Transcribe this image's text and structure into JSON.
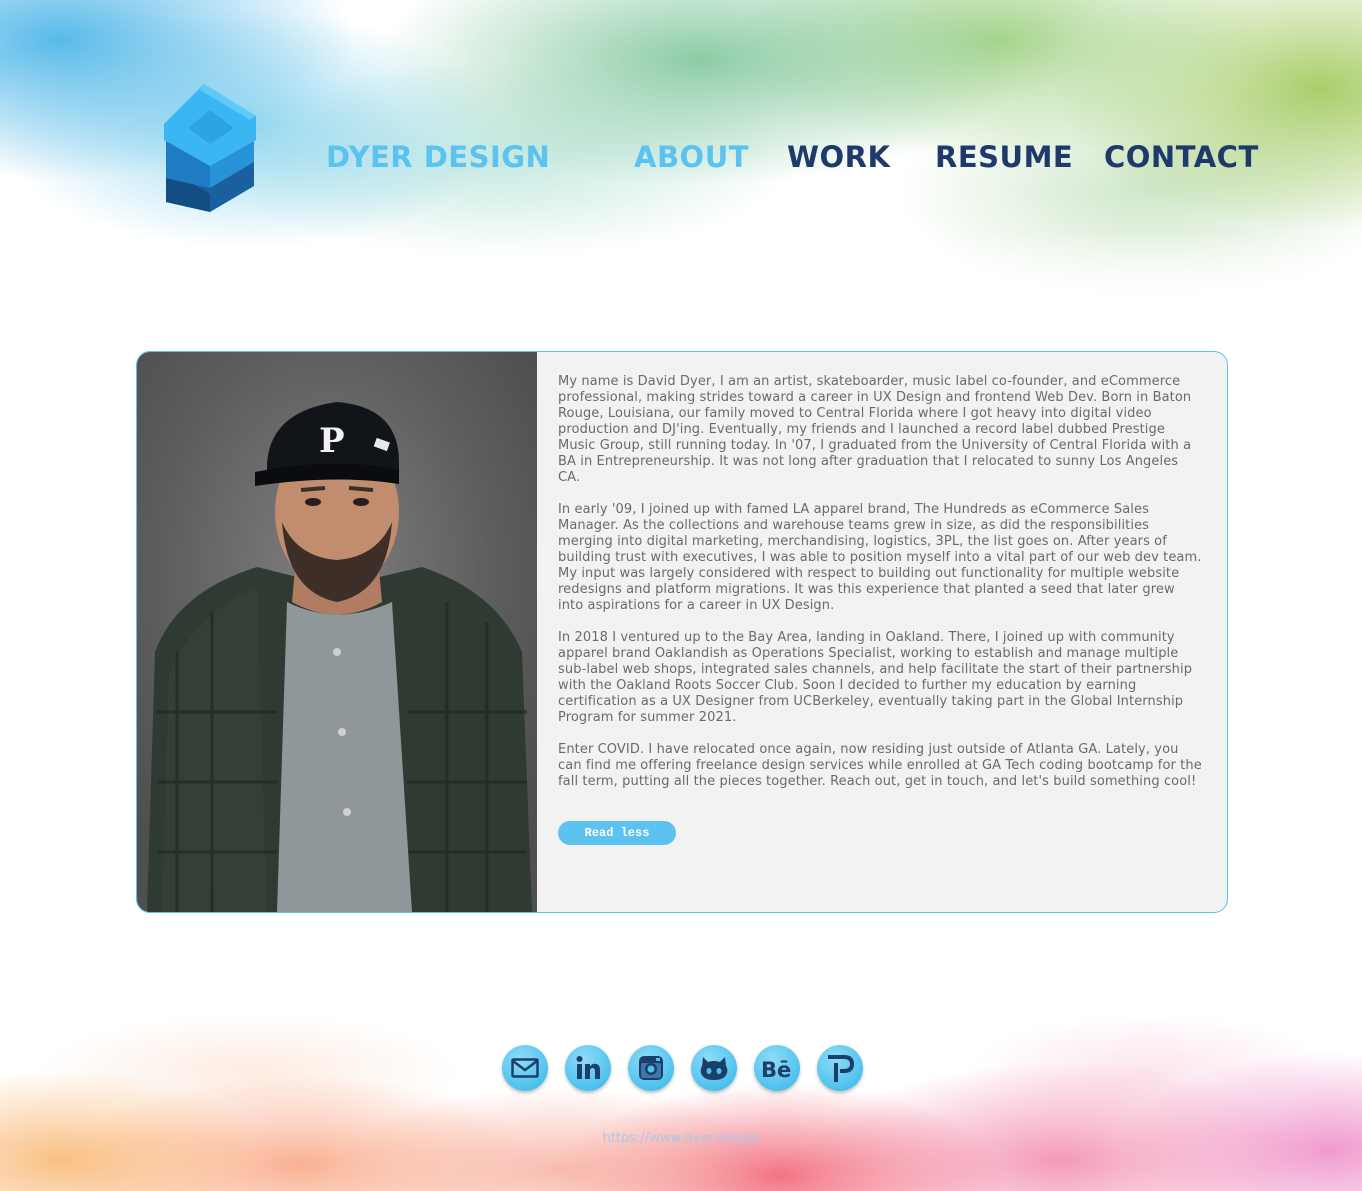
{
  "header": {
    "brand": "DYER DESIGN",
    "nav": [
      {
        "label": "ABOUT",
        "active": true
      },
      {
        "label": "WORK",
        "active": false
      },
      {
        "label": "RESUME",
        "active": false
      },
      {
        "label": "CONTACT",
        "active": false
      }
    ]
  },
  "about": {
    "paragraphs": [
      "My name is David Dyer, I am an artist, skateboarder, music label co-founder, and eCommerce professional, making strides toward a career in UX Design and frontend Web Dev. Born in Baton Rouge, Louisiana, our family moved to Central Florida where I got heavy into digital video production and DJ'ing. Eventually, my friends and I launched a record label dubbed Prestige Music Group, still running today. In '07, I graduated from the University of Central Florida with a BA in Entrepreneurship. It was not long after graduation that I relocated to sunny Los Angeles CA.",
      "In early '09, I joined up with famed LA apparel brand, The Hundreds as eCommerce Sales Manager. As the collections and warehouse teams grew in size, as did the responsibilities merging into digital marketing, merchandising, logistics, 3PL, the list goes on. After years of building trust with executives, I was able to position myself into a vital part of our web dev team. My input was largely considered with respect to building out functionality for multiple website redesigns and platform migrations. It was this experience that planted a seed that later grew into aspirations for a career in UX Design.",
      "In 2018 I ventured up to the Bay Area, landing in Oakland. There, I joined up with community apparel brand Oaklandish as Operations Specialist, working to establish and manage multiple sub-label web shops, integrated sales channels, and help facilitate the start of their partnership with the Oakland Roots Soccer Club. Soon I decided to further my education by earning certification as a UX Designer from UCBerkeley, eventually taking part in the Global Internship Program for summer 2021.",
      "Enter COVID. I have relocated once again, now residing just outside of Atlanta GA. Lately, you can find me offering freelance design services while enrolled at GA Tech coding bootcamp for the fall term, putting all the pieces together. Reach out, get in touch, and let's build something cool!"
    ],
    "read_less": "Read less"
  },
  "social": [
    {
      "name": "email-icon"
    },
    {
      "name": "linkedin-icon"
    },
    {
      "name": "instagram-icon"
    },
    {
      "name": "github-icon"
    },
    {
      "name": "behance-icon"
    },
    {
      "name": "portfolio-p-icon"
    }
  ],
  "footer": {
    "url": "https://www.dyer.design"
  },
  "colors": {
    "accent": "#5cc2ef",
    "navy": "#1e3a6b",
    "card_bg": "#f2f2f2"
  }
}
